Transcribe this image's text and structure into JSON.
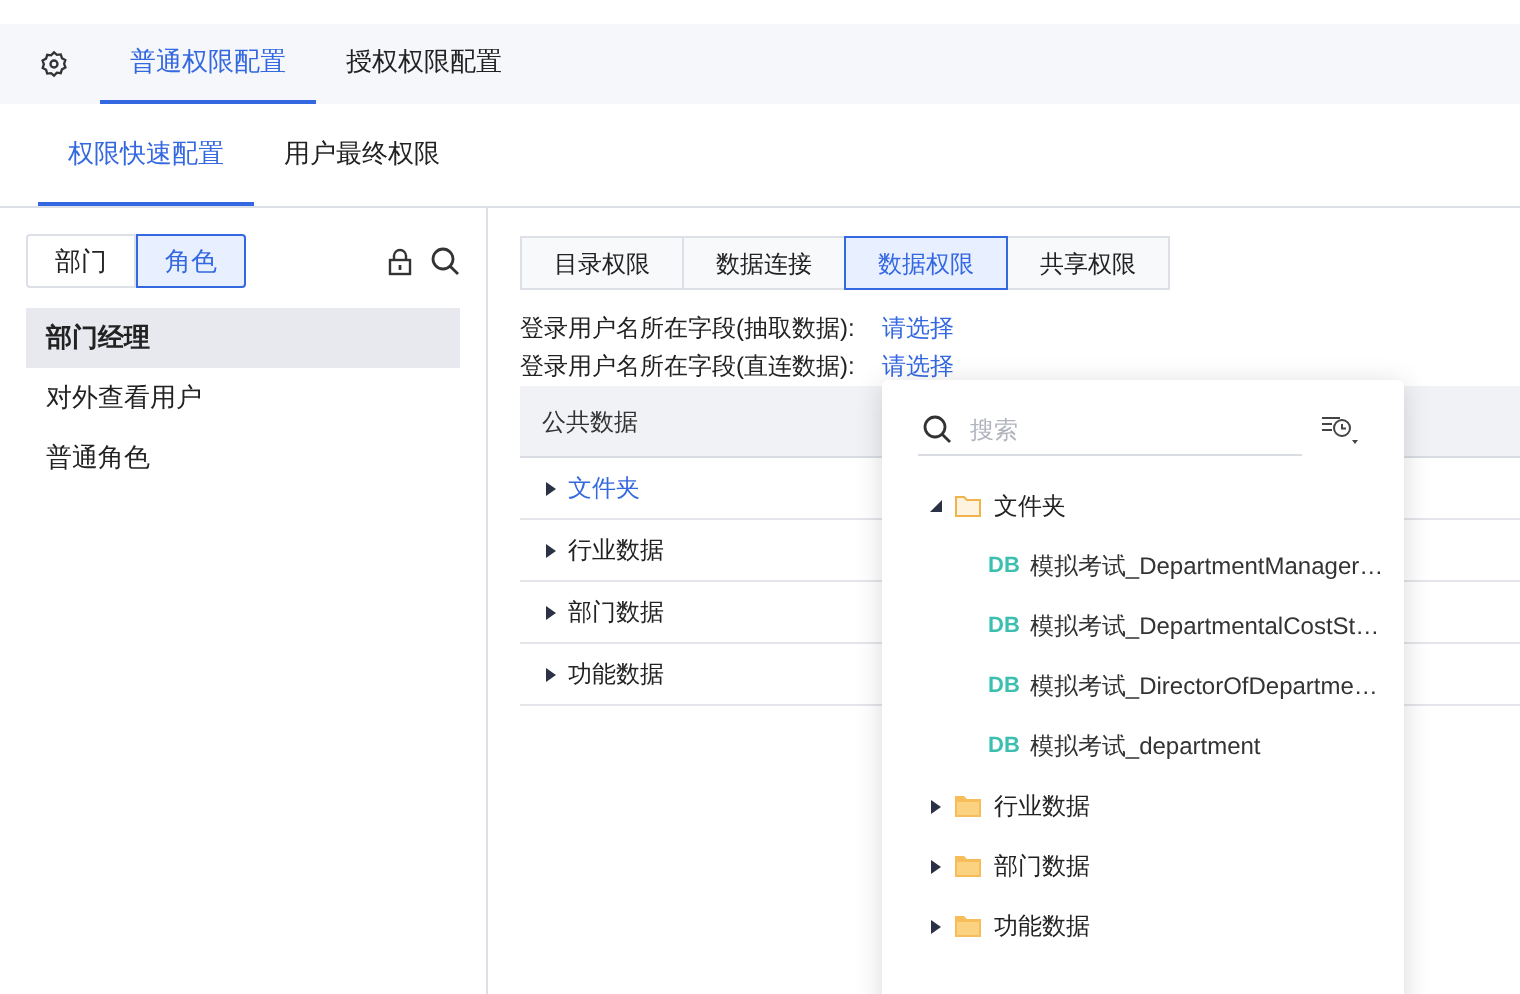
{
  "top_tabs": [
    {
      "label": "普通权限配置",
      "selected": true
    },
    {
      "label": "授权权限配置",
      "selected": false
    }
  ],
  "sub_tabs": [
    {
      "label": "权限快速配置",
      "selected": true
    },
    {
      "label": "用户最终权限",
      "selected": false
    }
  ],
  "sidebar": {
    "toggle": [
      {
        "label": "部门",
        "selected": false
      },
      {
        "label": "角色",
        "selected": true
      }
    ],
    "items": [
      {
        "label": "部门经理",
        "selected": true
      },
      {
        "label": "对外查看用户",
        "selected": false
      },
      {
        "label": "普通角色",
        "selected": false
      }
    ]
  },
  "perm_tabs": [
    {
      "label": "目录权限",
      "selected": false
    },
    {
      "label": "数据连接",
      "selected": false
    },
    {
      "label": "数据权限",
      "selected": true
    },
    {
      "label": "共享权限",
      "selected": false
    }
  ],
  "fields": [
    {
      "label": "登录用户名所在字段(抽取数据):",
      "value": "请选择"
    },
    {
      "label": "登录用户名所在字段(直连数据):",
      "value": "请选择"
    }
  ],
  "table": {
    "header": "公共数据",
    "rows": [
      {
        "label": "文件夹",
        "selected": true
      },
      {
        "label": "行业数据",
        "selected": false
      },
      {
        "label": "部门数据",
        "selected": false
      },
      {
        "label": "功能数据",
        "selected": false
      }
    ]
  },
  "popup": {
    "search": {
      "placeholder": "搜索"
    },
    "tree": [
      {
        "label": "文件夹",
        "expanded": true,
        "children": [
          {
            "badge": "DB",
            "label": "模拟考试_DepartmentManager…"
          },
          {
            "badge": "DB",
            "label": "模拟考试_DepartmentalCostSt…"
          },
          {
            "badge": "DB",
            "label": "模拟考试_DirectorOfDepartme…"
          },
          {
            "badge": "DB",
            "label": "模拟考试_department"
          }
        ]
      },
      {
        "label": "行业数据",
        "expanded": false
      },
      {
        "label": "部门数据",
        "expanded": false
      },
      {
        "label": "功能数据",
        "expanded": false
      }
    ]
  }
}
